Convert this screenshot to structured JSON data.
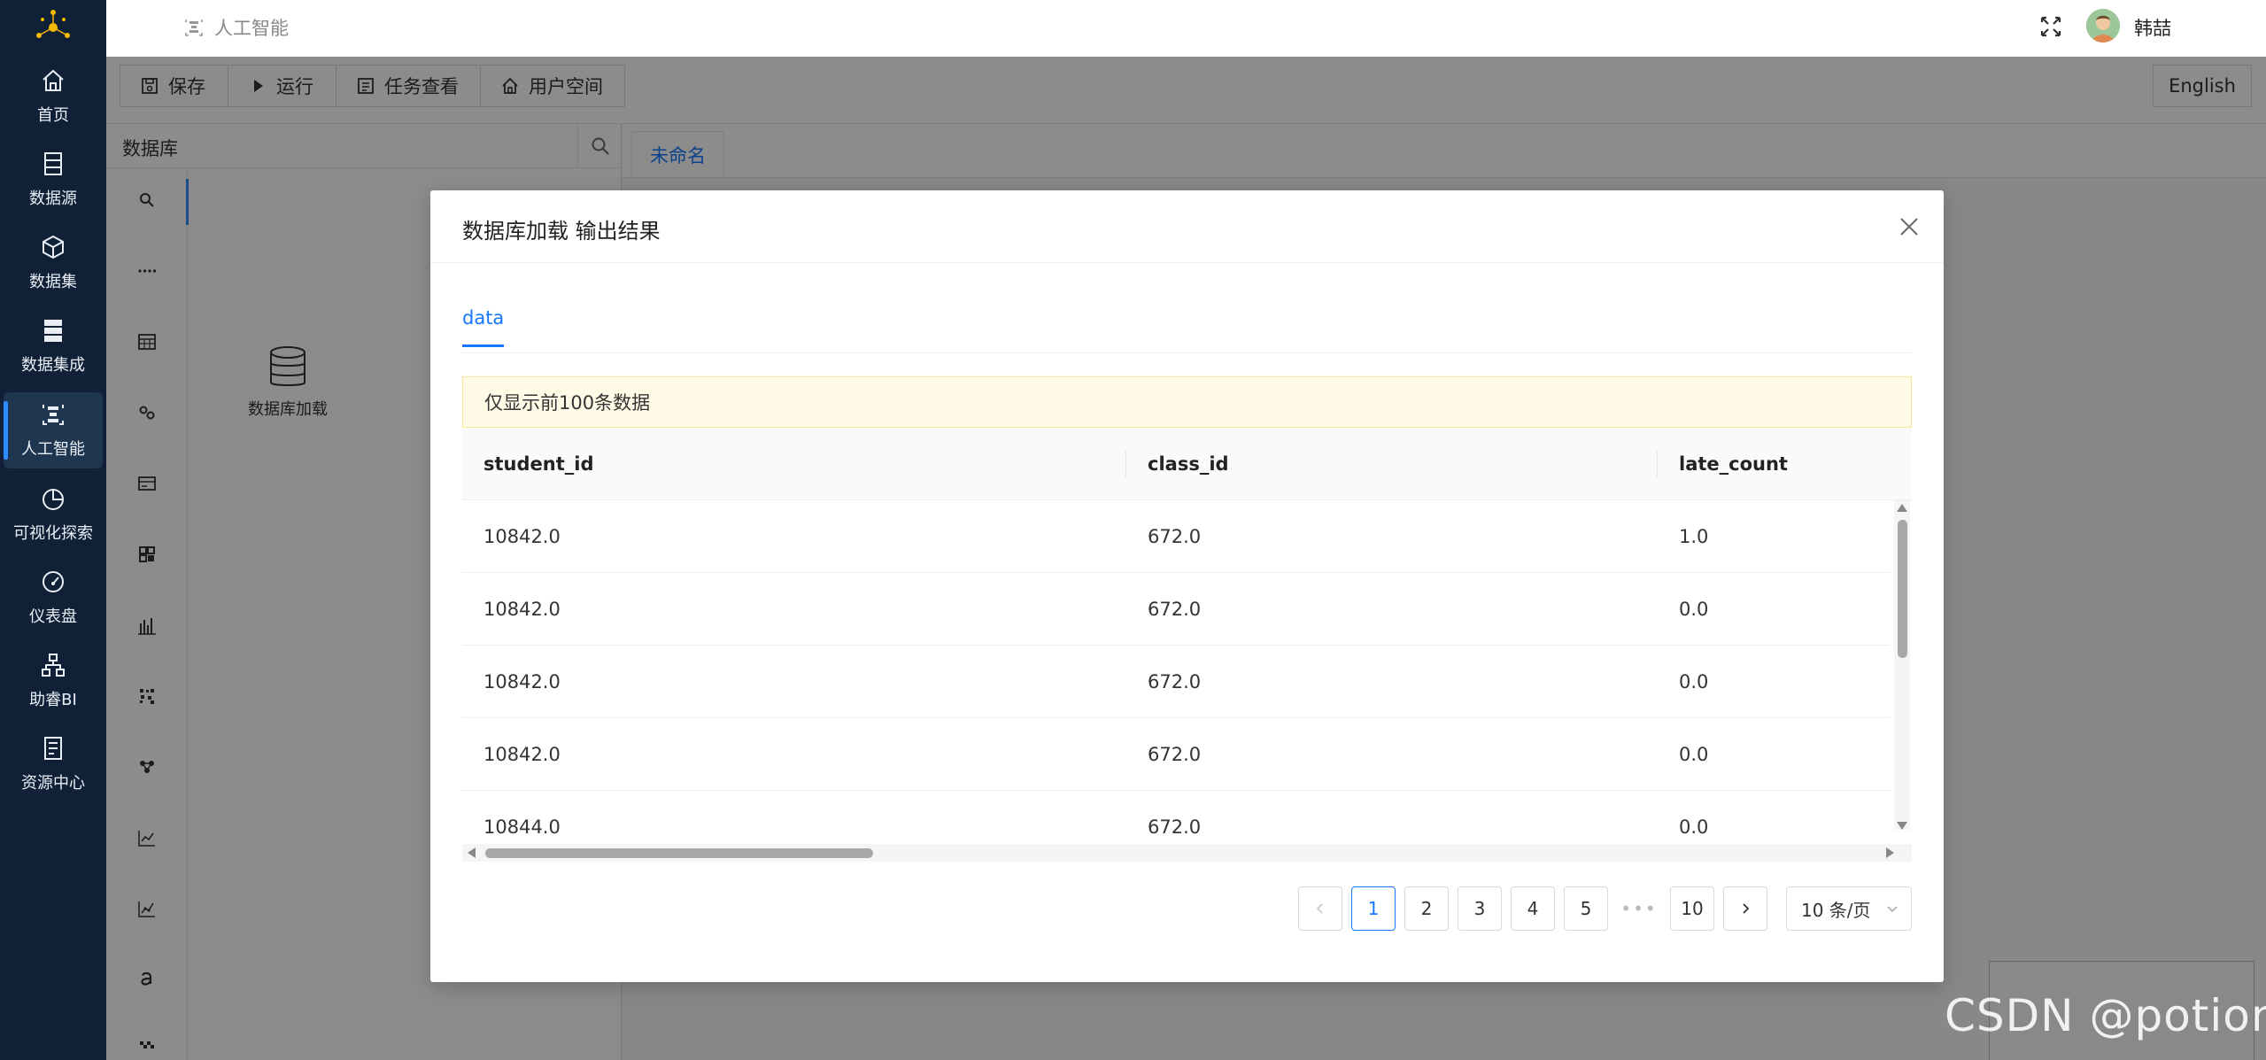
{
  "nav": {
    "items": [
      {
        "label": "首页",
        "icon": "home-icon"
      },
      {
        "label": "数据源",
        "icon": "datasource-icon"
      },
      {
        "label": "数据集",
        "icon": "dataset-icon"
      },
      {
        "label": "数据集成",
        "icon": "data-integration-icon"
      },
      {
        "label": "人工智能",
        "icon": "ai-icon"
      },
      {
        "label": "可视化探索",
        "icon": "pie-chart-icon"
      },
      {
        "label": "仪表盘",
        "icon": "dashboard-icon"
      },
      {
        "label": "助睿BI",
        "icon": "org-chart-icon"
      },
      {
        "label": "资源中心",
        "icon": "resource-icon"
      }
    ],
    "active": "人工智能"
  },
  "topbar": {
    "breadcrumb": "人工智能",
    "user_name": "韩喆"
  },
  "toolbar": {
    "save": "保存",
    "run": "运行",
    "tasks": "任务查看",
    "user_space": "用户空间",
    "language": "English"
  },
  "left_panel": {
    "search_label": "数据库",
    "node_label": "数据库加载"
  },
  "canvas": {
    "tab": "未命名"
  },
  "modal": {
    "title": "数据库加载 输出结果",
    "tab": "data",
    "notice": "仅显示前100条数据",
    "columns": [
      "student_id",
      "class_id",
      "late_count"
    ],
    "rows": [
      [
        "10842.0",
        "672.0",
        "1.0"
      ],
      [
        "10842.0",
        "672.0",
        "0.0"
      ],
      [
        "10842.0",
        "672.0",
        "0.0"
      ],
      [
        "10842.0",
        "672.0",
        "0.0"
      ],
      [
        "10844.0",
        "672.0",
        "0.0"
      ]
    ],
    "pagination": {
      "pages": [
        "1",
        "2",
        "3",
        "4",
        "5"
      ],
      "ellipsis": "•••",
      "last_page": "10",
      "current": "1",
      "page_size": "10 条/页"
    }
  },
  "watermark": "CSDN @potion()",
  "colors": {
    "nav_bg": "#0f2037",
    "accent": "#1677ff",
    "notice_bg": "#fffbe6"
  }
}
